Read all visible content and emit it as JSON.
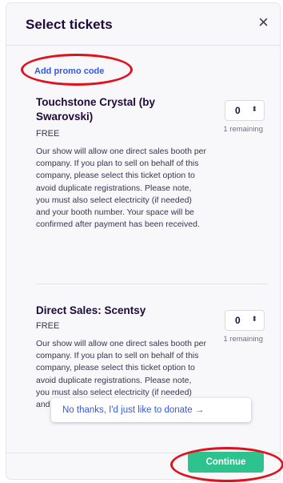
{
  "modal": {
    "title": "Select tickets",
    "close_icon": "×"
  },
  "promo": {
    "label": "Add promo code"
  },
  "tickets": [
    {
      "name": "Touchstone Crystal (by Swarovski)",
      "price": "FREE",
      "description": "Our show will allow one direct sales booth per company. If you plan to sell on behalf of this company, please select this ticket option to avoid duplicate registrations. Please note, you must also select electricity (if needed) and your booth number. Your space will be confirmed after payment has been received.",
      "quantity": "0",
      "remaining": "1 remaining"
    },
    {
      "name": "Direct Sales: Scentsy",
      "price": "FREE",
      "description": "Our show will allow one direct sales booth per company. If you plan to sell on behalf of this company, please select this ticket option to avoid duplicate registrations. Please note, you must also select electricity (if needed) and your booth number. Your space will be",
      "quantity": "0",
      "remaining": "1 remaining"
    }
  ],
  "donate": {
    "label": "No thanks, I'd just like to donate →"
  },
  "footer": {
    "continue_label": "Continue"
  },
  "colors": {
    "accent": "#3659e3",
    "continue_button": "#2ec28f",
    "annotation_ellipse": "#e0101c"
  },
  "icons": {
    "close": "close-icon",
    "quantity_chevron": "chevron-updown-icon"
  }
}
